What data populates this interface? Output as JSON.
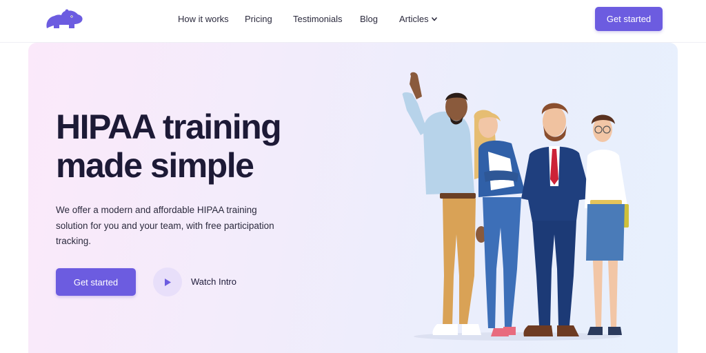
{
  "header": {
    "logo_icon": "hippo-logo-icon",
    "nav": {
      "how_it_works": "How it works",
      "pricing": "Pricing",
      "testimonials": "Testimonials",
      "blog": "Blog",
      "articles": "Articles"
    },
    "cta_label": "Get started"
  },
  "hero": {
    "title_line1": "HIPAA training",
    "title_line2": "made simple",
    "description": "We offer a modern and affordable HIPAA training solution for you and your team, with free participation tracking.",
    "cta_label": "Get started",
    "watch_label": "Watch Intro",
    "illustration_icon": "team-of-four-people-illustration"
  },
  "colors": {
    "accent": "#6c5ce0",
    "heading": "#1d1a36",
    "play_bg": "#e8dffa"
  }
}
